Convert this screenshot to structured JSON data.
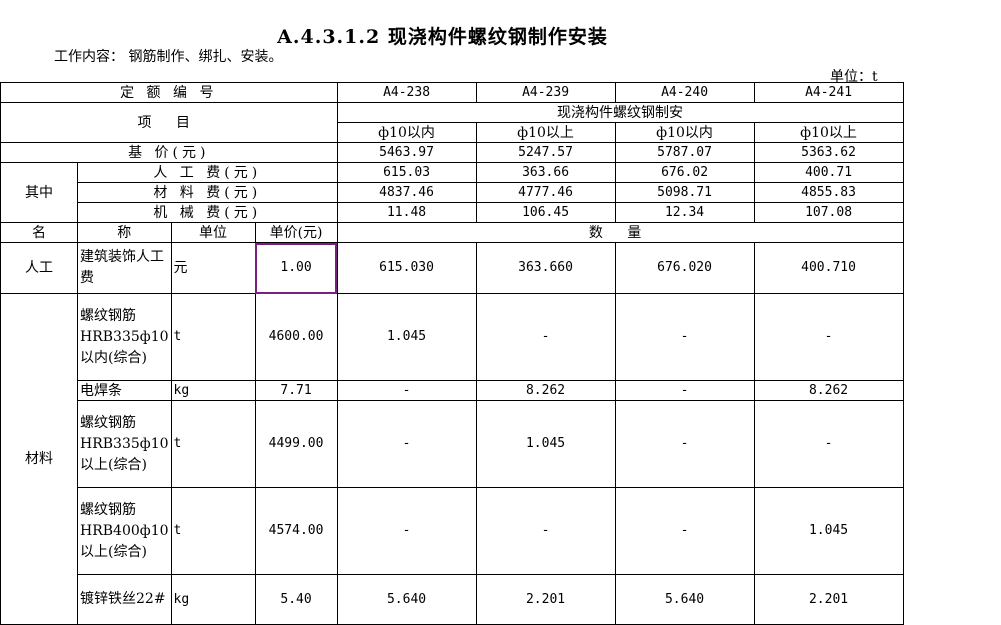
{
  "title": "A.4.3.1.2 现浇构件螺纹钢制作安装",
  "work_content": "工作内容： 钢筋制作、绑扎、安装。",
  "unit": "单位：t",
  "header": {
    "code_label": "定 额 编 号",
    "codes": [
      "A4-238",
      "A4-239",
      "A4-240",
      "A4-241"
    ],
    "item_label": "项 目",
    "group_title": "现浇构件螺纹钢制安",
    "specs": [
      "ф10以内",
      "ф10以上",
      "ф10以内",
      "ф10以上"
    ],
    "base_price_label": "基 价(元)",
    "base_prices": [
      "5463.97",
      "5247.57",
      "5787.07",
      "5363.62"
    ],
    "of_which_label": "其中",
    "costs": [
      {
        "label": "人 工 费(元)",
        "values": [
          "615.03",
          "363.66",
          "676.02",
          "400.71"
        ]
      },
      {
        "label": "材 料 费(元)",
        "values": [
          "4837.46",
          "4777.46",
          "5098.71",
          "4855.83"
        ]
      },
      {
        "label": "机 械 费(元)",
        "values": [
          "11.48",
          "106.45",
          "12.34",
          "107.08"
        ]
      }
    ],
    "col_name": "名",
    "col_name2": "称",
    "col_unit": "单位",
    "col_price": "单价(元)",
    "col_qty": "数 量"
  },
  "labor": {
    "category": "人工",
    "name": "建筑装饰人工费",
    "unit": "元",
    "price": "1.00",
    "qty": [
      "615.030",
      "363.660",
      "676.020",
      "400.710"
    ]
  },
  "materials": {
    "category": "材料",
    "rows": [
      {
        "name": "螺纹钢筋HRB335ф10以内(综合)",
        "unit": "t",
        "price": "4600.00",
        "qty": [
          "1.045",
          "-",
          "-",
          "-"
        ]
      },
      {
        "name": "电焊条",
        "unit": "kg",
        "price": "7.71",
        "qty": [
          "-",
          "8.262",
          "-",
          "8.262"
        ]
      },
      {
        "name": "螺纹钢筋HRB335ф10以上(综合)",
        "unit": "t",
        "price": "4499.00",
        "qty": [
          "-",
          "1.045",
          "-",
          "-"
        ]
      },
      {
        "name": "螺纹钢筋HRB400ф10以上(综合)",
        "unit": "t",
        "price": "4574.00",
        "qty": [
          "-",
          "-",
          "-",
          "1.045"
        ]
      },
      {
        "name": "镀锌铁丝22#",
        "unit": "kg",
        "price": "5.40",
        "qty": [
          "5.640",
          "2.201",
          "5.640",
          "2.201"
        ]
      }
    ]
  }
}
